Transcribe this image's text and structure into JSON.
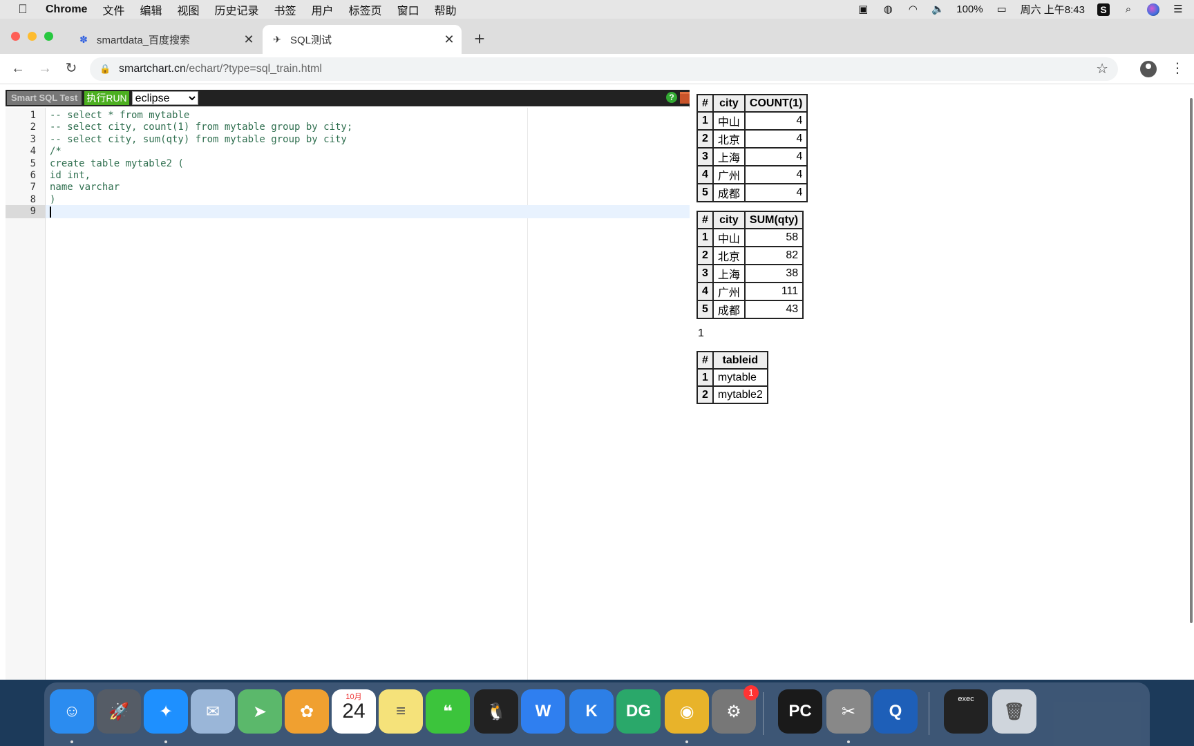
{
  "menubar": {
    "apple": "",
    "app": "Chrome",
    "items": [
      "文件",
      "编辑",
      "视图",
      "历史记录",
      "书签",
      "用户",
      "标签页",
      "窗口",
      "帮助"
    ],
    "battery": "100%",
    "clock": "周六 上午8:43"
  },
  "tabs": [
    {
      "title": "smartdata_百度搜索",
      "close": "✕"
    },
    {
      "title": "SQL测试",
      "close": "✕"
    }
  ],
  "newtab": "+",
  "toolbar": {
    "url_host": "smartchart.cn",
    "url_path": "/echart/?type=sql_train.html"
  },
  "editor": {
    "brand": "Smart SQL Test",
    "run_label": "执行RUN",
    "theme_options": [
      "eclipse"
    ],
    "help": "?",
    "lines": [
      {
        "n": "1",
        "text": "-- select * from mytable",
        "kind": "comment"
      },
      {
        "n": "2",
        "text": "-- select city, count(1) from mytable group by city;",
        "kind": "comment"
      },
      {
        "n": "3",
        "text": "-- select city, sum(qty) from mytable group by city",
        "kind": "comment"
      },
      {
        "n": "4",
        "text": "/*",
        "kind": "comment"
      },
      {
        "n": "5",
        "text": "create table mytable2 (",
        "kind": "comment"
      },
      {
        "n": "6",
        "text": "id int,",
        "kind": "comment"
      },
      {
        "n": "7",
        "text": "name varchar",
        "kind": "comment"
      },
      {
        "n": "8",
        "text": ")",
        "kind": "comment"
      },
      {
        "n": "9",
        "text": "",
        "kind": "plain"
      }
    ]
  },
  "results": {
    "table1": {
      "headers": [
        "#",
        "city",
        "COUNT(1)"
      ],
      "rows": [
        [
          "1",
          "中山",
          "4"
        ],
        [
          "2",
          "北京",
          "4"
        ],
        [
          "3",
          "上海",
          "4"
        ],
        [
          "4",
          "广州",
          "4"
        ],
        [
          "5",
          "成都",
          "4"
        ]
      ]
    },
    "table2": {
      "headers": [
        "#",
        "city",
        "SUM(qty)"
      ],
      "rows": [
        [
          "1",
          "中山",
          "58"
        ],
        [
          "2",
          "北京",
          "82"
        ],
        [
          "3",
          "上海",
          "38"
        ],
        [
          "4",
          "广州",
          "111"
        ],
        [
          "5",
          "成都",
          "43"
        ]
      ]
    },
    "message": "1",
    "table3": {
      "headers": [
        "#",
        "tableid"
      ],
      "rows": [
        [
          "1",
          "mytable"
        ],
        [
          "2",
          "mytable2"
        ]
      ]
    }
  },
  "dock": {
    "items": [
      {
        "name": "finder-icon",
        "glyph": "☺",
        "color": "#2b8cf0"
      },
      {
        "name": "launchpad-icon",
        "glyph": "🚀",
        "color": "#555c66"
      },
      {
        "name": "safari-icon",
        "glyph": "✦",
        "color": "#1e90ff"
      },
      {
        "name": "mail-icon",
        "glyph": "✉",
        "color": "#9ab6d8"
      },
      {
        "name": "maps-icon",
        "glyph": "➤",
        "color": "#5bb86b"
      },
      {
        "name": "photos-icon",
        "glyph": "✿",
        "color": "#f0a030"
      },
      {
        "name": "calendar-icon",
        "glyph": "24",
        "color": "#ffffff"
      },
      {
        "name": "notes-icon",
        "glyph": "≡",
        "color": "#f5e27a"
      },
      {
        "name": "wechat-icon",
        "glyph": "❝",
        "color": "#3cc43c"
      },
      {
        "name": "qq-icon",
        "glyph": "🐧",
        "color": "#222222"
      },
      {
        "name": "wps-icon",
        "glyph": "W",
        "color": "#2f7ff0"
      },
      {
        "name": "kuaibo-icon",
        "glyph": "K",
        "color": "#2d7fe6"
      },
      {
        "name": "datagrip-icon",
        "glyph": "DG",
        "color": "#2aa86a"
      },
      {
        "name": "chrome-icon",
        "glyph": "◉",
        "color": "#e8b32a"
      },
      {
        "name": "system-preferences-icon",
        "glyph": "⚙",
        "color": "#777777"
      },
      {
        "name": "pycharm-icon",
        "glyph": "PC",
        "color": "#1a1a1a"
      },
      {
        "name": "video-editor-icon",
        "glyph": "✂",
        "color": "#888888"
      },
      {
        "name": "quicktime-icon",
        "glyph": "Q",
        "color": "#1e5fb8"
      },
      {
        "name": "terminal-icon",
        "glyph": "exec",
        "color": "#222222"
      },
      {
        "name": "trash-icon",
        "glyph": "🗑",
        "color": "#cfd5dc"
      }
    ],
    "badge": "1",
    "calendar_month": "10月"
  }
}
